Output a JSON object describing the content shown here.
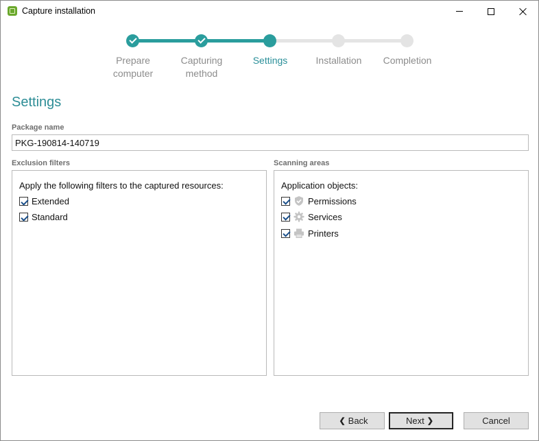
{
  "window": {
    "title": "Capture installation"
  },
  "stepper": {
    "steps": [
      {
        "label": "Prepare computer",
        "line1": "Prepare",
        "line2": "computer",
        "state": "done"
      },
      {
        "label": "Capturing method",
        "line1": "Capturing",
        "line2": "method",
        "state": "done"
      },
      {
        "label": "Settings",
        "line1": "Settings",
        "line2": "",
        "state": "current"
      },
      {
        "label": "Installation",
        "line1": "Installation",
        "line2": "",
        "state": "todo"
      },
      {
        "label": "Completion",
        "line1": "Completion",
        "line2": "",
        "state": "todo"
      }
    ],
    "accent_color": "#2a9d9d",
    "inactive_color": "#e4e4e4"
  },
  "page": {
    "title": "Settings"
  },
  "package": {
    "label": "Package name",
    "value": "PKG-190814-140719"
  },
  "exclusion_filters": {
    "label": "Exclusion filters",
    "heading": "Apply the following filters to the captured resources:",
    "items": [
      {
        "label": "Extended",
        "checked": true
      },
      {
        "label": "Standard",
        "checked": true
      }
    ]
  },
  "scanning_areas": {
    "label": "Scanning areas",
    "heading": "Application objects:",
    "items": [
      {
        "label": "Permissions",
        "checked": true,
        "icon": "shield-icon"
      },
      {
        "label": "Services",
        "checked": true,
        "icon": "gear-icon"
      },
      {
        "label": "Printers",
        "checked": true,
        "icon": "printer-icon"
      }
    ]
  },
  "footer": {
    "back_label": "Back",
    "next_label": "Next",
    "cancel_label": "Cancel"
  }
}
